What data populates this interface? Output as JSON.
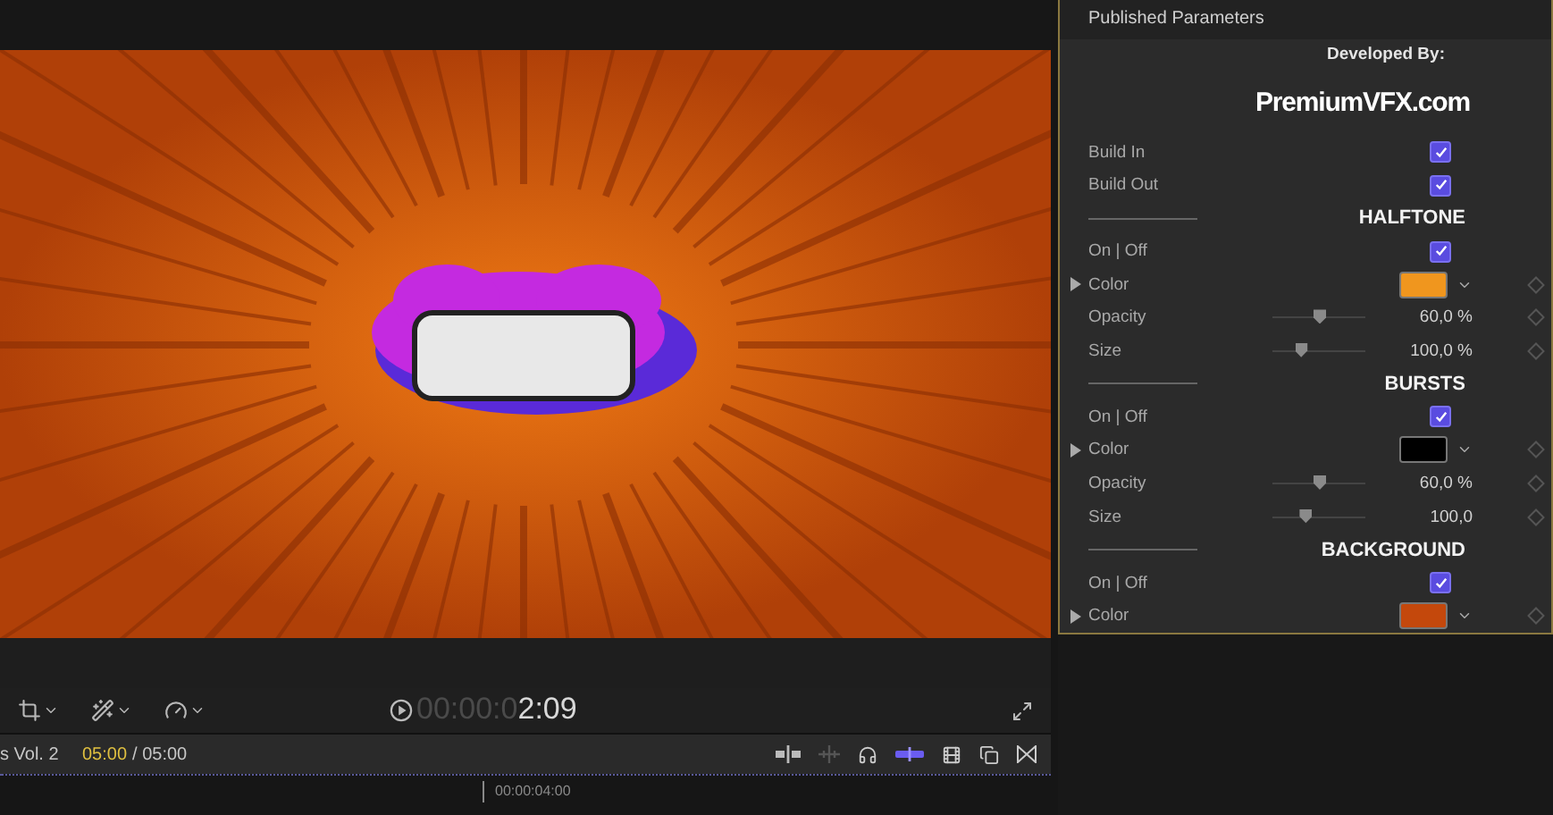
{
  "viewer": {
    "timecode_dim": "00:00:0",
    "timecode": "2:09"
  },
  "timeline": {
    "project": "s Vol. 2",
    "position": "05:00",
    "duration": "/ 05:00",
    "ruler_label": "00:00:04:00",
    "snapping": true
  },
  "inspector": {
    "title": "Published Parameters",
    "credit": "Developed By:",
    "logo": "PremiumVFX.com",
    "rows": [
      {
        "kind": "checkbox",
        "label": "Build In",
        "checked": true
      },
      {
        "kind": "checkbox",
        "label": "Build Out",
        "checked": true
      },
      {
        "kind": "heading",
        "label": "HALFTONE"
      },
      {
        "kind": "checkbox",
        "label": "On | Off",
        "checked": true
      },
      {
        "kind": "color",
        "label": "Color",
        "color": "#f0961e",
        "expanded": false
      },
      {
        "kind": "slider",
        "label": "Opacity",
        "level": 0.5,
        "value": "60,0 %"
      },
      {
        "kind": "slider",
        "label": "Size",
        "level": 0.3,
        "value": "100,0 %"
      },
      {
        "kind": "heading",
        "label": "BURSTS"
      },
      {
        "kind": "checkbox",
        "label": "On | Off",
        "checked": true
      },
      {
        "kind": "color",
        "label": "Color",
        "color": "#000000",
        "expanded": false
      },
      {
        "kind": "slider",
        "label": "Opacity",
        "level": 0.5,
        "value": "60,0 %"
      },
      {
        "kind": "slider",
        "label": "Size",
        "level": 0.35,
        "value": "100,0"
      },
      {
        "kind": "heading",
        "label": "BACKGROUND"
      },
      {
        "kind": "checkbox",
        "label": "On | Off",
        "checked": true
      },
      {
        "kind": "color",
        "label": "Color",
        "color": "#c4480c",
        "expanded": false
      }
    ]
  }
}
